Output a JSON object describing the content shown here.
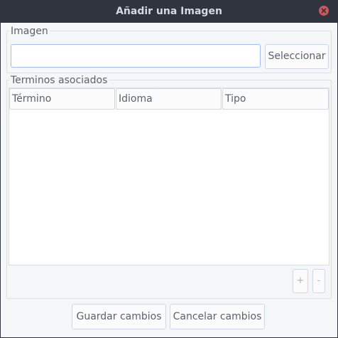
{
  "window": {
    "title": "Añadir una Imagen"
  },
  "image_group": {
    "label": "Imagen",
    "path_value": "",
    "select_label": "Seleccionar"
  },
  "terms_group": {
    "label": "Terminos asociados",
    "columns": [
      "Término",
      "Idioma",
      "Tipo"
    ],
    "rows": [],
    "add_label": "+",
    "remove_label": "-"
  },
  "footer": {
    "save_label": "Guardar cambios",
    "cancel_label": "Cancelar cambios"
  },
  "colors": {
    "titlebar": "#2f343f",
    "title_text": "#d3dae3",
    "close": "#cc575d",
    "background": "#f5f6f7",
    "text": "#5c616c",
    "input_focus_border": "#9fbef0"
  },
  "icons": {
    "close": "close-icon"
  }
}
